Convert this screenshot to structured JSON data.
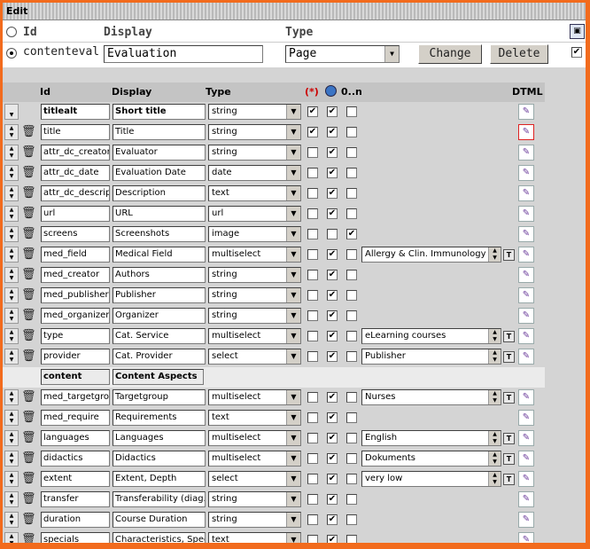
{
  "window": {
    "title": "Edit"
  },
  "type_panel": {
    "headers": {
      "id": "Id",
      "display": "Display",
      "type": "Type"
    },
    "current": {
      "id": "contenteval",
      "display": "Evaluation",
      "type": "Page"
    },
    "buttons": {
      "change": "Change",
      "delete": "Delete"
    }
  },
  "grid": {
    "headers": {
      "id": "Id",
      "display": "Display",
      "type": "Type",
      "required": "(*)",
      "onen": "0..n",
      "dtml": "DTML"
    },
    "rows": [
      {
        "kind": "field",
        "first": true,
        "id": "titlealt",
        "display": "Short title",
        "type": "string",
        "required": true,
        "global": true,
        "multi": false,
        "bold": true
      },
      {
        "kind": "field",
        "id": "title",
        "display": "Title",
        "type": "string",
        "required": true,
        "global": true,
        "multi": false,
        "highlight_icon": true
      },
      {
        "kind": "field",
        "id": "attr_dc_creator",
        "display": "Evaluator",
        "type": "string",
        "required": false,
        "global": true,
        "multi": false
      },
      {
        "kind": "field",
        "id": "attr_dc_date",
        "display": "Evaluation Date",
        "type": "date",
        "required": false,
        "global": true,
        "multi": false
      },
      {
        "kind": "field",
        "id": "attr_dc_descrip",
        "display": "Description",
        "type": "text",
        "required": false,
        "global": true,
        "multi": false
      },
      {
        "kind": "field",
        "id": "url",
        "display": "URL",
        "type": "url",
        "required": false,
        "global": true,
        "multi": false
      },
      {
        "kind": "field",
        "id": "screens",
        "display": "Screenshots",
        "type": "image",
        "required": false,
        "global": false,
        "multi": true
      },
      {
        "kind": "field",
        "id": "med_field",
        "display": "Medical Field",
        "type": "multiselect",
        "required": false,
        "global": true,
        "multi": false,
        "option": "Allergy & Clin. Immunology"
      },
      {
        "kind": "field",
        "id": "med_creator",
        "display": "Authors",
        "type": "string",
        "required": false,
        "global": true,
        "multi": false
      },
      {
        "kind": "field",
        "id": "med_publisher",
        "display": "Publisher",
        "type": "string",
        "required": false,
        "global": true,
        "multi": false
      },
      {
        "kind": "field",
        "id": "med_organizer",
        "display": "Organizer",
        "type": "string",
        "required": false,
        "global": true,
        "multi": false
      },
      {
        "kind": "field",
        "id": "type",
        "display": "Cat. Service",
        "type": "multiselect",
        "required": false,
        "global": true,
        "multi": false,
        "option": "eLearning courses"
      },
      {
        "kind": "field",
        "id": "provider",
        "display": "Cat. Provider",
        "type": "select",
        "required": false,
        "global": true,
        "multi": false,
        "option": "Publisher"
      },
      {
        "kind": "group",
        "id": "content",
        "display": "Content Aspects"
      },
      {
        "kind": "field",
        "id": "med_targetgrou",
        "display": "Targetgroup",
        "type": "multiselect",
        "required": false,
        "global": true,
        "multi": false,
        "option": "Nurses"
      },
      {
        "kind": "field",
        "id": "med_require",
        "display": "Requirements",
        "type": "text",
        "required": false,
        "global": true,
        "multi": false
      },
      {
        "kind": "field",
        "id": "languages",
        "display": "Languages",
        "type": "multiselect",
        "required": false,
        "global": true,
        "multi": false,
        "option": "English"
      },
      {
        "kind": "field",
        "id": "didactics",
        "display": "Didactics",
        "type": "multiselect",
        "required": false,
        "global": true,
        "multi": false,
        "option": "Dokuments"
      },
      {
        "kind": "field",
        "id": "extent",
        "display": "Extent, Depth",
        "type": "select",
        "required": false,
        "global": true,
        "multi": false,
        "option": "very low"
      },
      {
        "kind": "field",
        "id": "transfer",
        "display": "Transferability (diag.,",
        "type": "string",
        "required": false,
        "global": true,
        "multi": false
      },
      {
        "kind": "field",
        "id": "duration",
        "display": "Course Duration",
        "type": "string",
        "required": false,
        "global": true,
        "multi": false
      },
      {
        "kind": "field",
        "id": "specials",
        "display": "Characteristics, Speci",
        "type": "text",
        "required": false,
        "global": true,
        "multi": false
      }
    ]
  },
  "colors": {
    "frame": "#f26b1d",
    "panel": "#d4d4d4",
    "header": "#c4c4c4",
    "group": "#ebebeb"
  },
  "icons": {
    "move": "up-down-arrows-icon",
    "delete": "trash-icon",
    "globe": "globe-icon",
    "dtml": "dtml-edit-icon",
    "text": "text-edit-icon"
  }
}
